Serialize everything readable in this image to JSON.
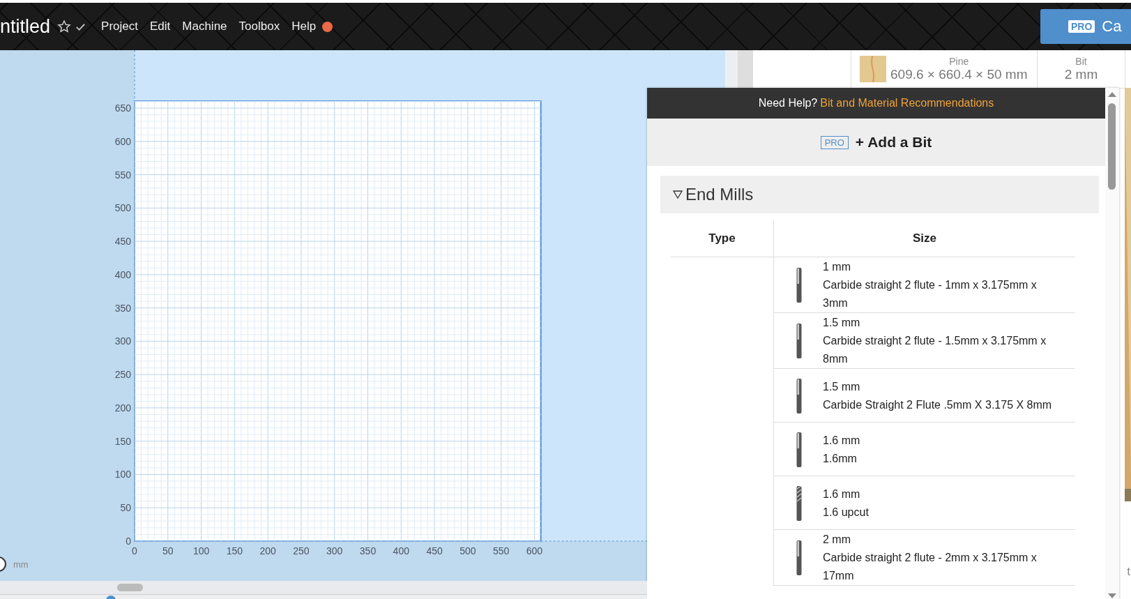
{
  "header": {
    "title": "ntitled",
    "starred": false,
    "saved": true,
    "menu": [
      {
        "label": "Project"
      },
      {
        "label": "Edit"
      },
      {
        "label": "Machine"
      },
      {
        "label": "Toolbox"
      },
      {
        "label": "Help",
        "notification": true
      }
    ],
    "cta": {
      "badge": "PRO",
      "label": "Ca"
    }
  },
  "material": {
    "name": "Pine",
    "dimensions": "609.6 × 660.4 × 50 mm"
  },
  "bit": {
    "label": "Bit",
    "value": "2 mm"
  },
  "canvas": {
    "x_ticks": [
      "0",
      "50",
      "100",
      "150",
      "200",
      "250",
      "300",
      "350",
      "400",
      "450",
      "500",
      "550",
      "600"
    ],
    "y_ticks": [
      "650",
      "600",
      "550",
      "500",
      "450",
      "400",
      "350",
      "300",
      "250",
      "200",
      "150",
      "100",
      "50",
      "0"
    ],
    "unit": "mm"
  },
  "bit_panel": {
    "help_text": "Need Help?",
    "help_link": "Bit and Material Recommendations",
    "add_badge": "PRO",
    "add_label": "+ Add a Bit",
    "section": {
      "title": "End Mills",
      "expanded": true,
      "columns": [
        "Type",
        "Size"
      ],
      "rows": [
        {
          "kind": "straight",
          "size": "1 mm",
          "description": "Carbide straight 2 flute - 1mm x 3.175mm x 3mm"
        },
        {
          "kind": "straight",
          "size": "1.5 mm",
          "description": "Carbide straight 2 flute - 1.5mm x 3.175mm x 8mm"
        },
        {
          "kind": "straight",
          "size": "1.5 mm",
          "description": "Carbide Straight 2 Flute .5mm X 3.175 X 8mm"
        },
        {
          "kind": "straight",
          "size": "1.6 mm",
          "description": "1.6mm"
        },
        {
          "kind": "spiral",
          "size": "1.6 mm",
          "description": "1.6 upcut"
        },
        {
          "kind": "straight",
          "size": "2 mm",
          "description": "Carbide straight 2 flute - 2mm x 3.175mm x 17mm"
        }
      ]
    }
  },
  "edge_text": "t"
}
